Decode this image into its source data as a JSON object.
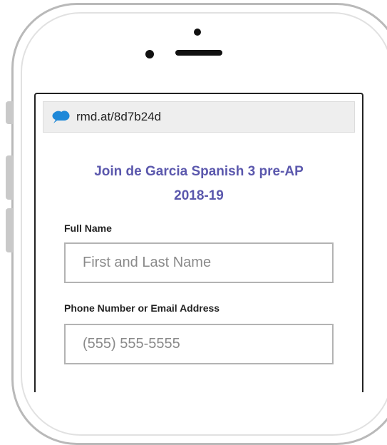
{
  "browser": {
    "url": "rmd.at/8d7b24d"
  },
  "form": {
    "title_line1": "Join de Garcia Spanish 3 pre-AP",
    "title_line2": "2018-19",
    "full_name": {
      "label": "Full Name",
      "placeholder": "First and Last Name",
      "value": ""
    },
    "contact": {
      "label": "Phone Number or Email Address",
      "placeholder": "(555) 555-5555",
      "value": ""
    }
  },
  "colors": {
    "accent": "#5b58ad",
    "logo": "#1e88d8"
  },
  "icons": {
    "logo": "remind-cloud-icon"
  }
}
